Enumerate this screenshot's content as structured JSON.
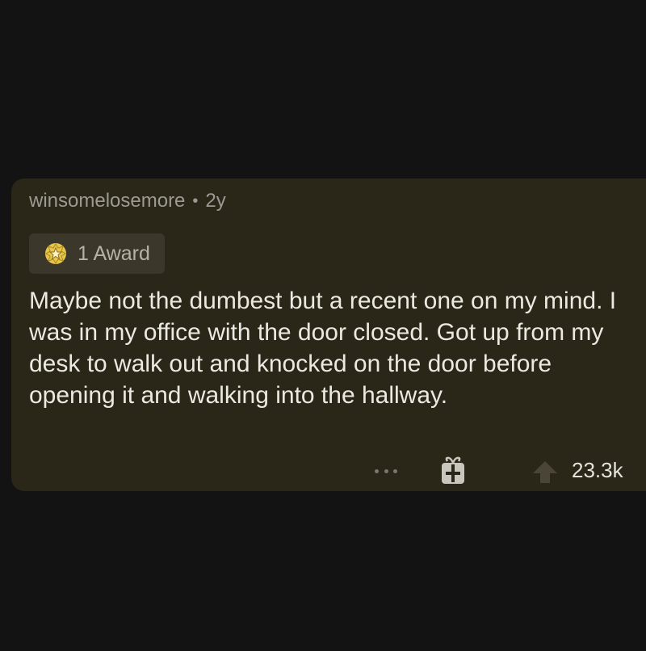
{
  "comment": {
    "username": "winsomelosemore",
    "separator": "•",
    "age": "2y",
    "award_label": "1 Award",
    "body": "Maybe not the dumbest but a recent one on my mind. I was in my office with the door closed. Got up from my desk to walk out and knocked on the door before opening it and walking into the hallway.",
    "vote_count": "23.3k"
  },
  "icons": {
    "award": "award-badge-icon",
    "more": "more-options-icon",
    "gift": "gift-icon",
    "upvote": "upvote-arrow-icon"
  },
  "colors": {
    "background": "#131313",
    "card": "#2a2618",
    "chip": "#3b372a",
    "award_gold": "#e8c547",
    "meta_text": "#9c9a92",
    "body_text": "#ece9e2"
  }
}
